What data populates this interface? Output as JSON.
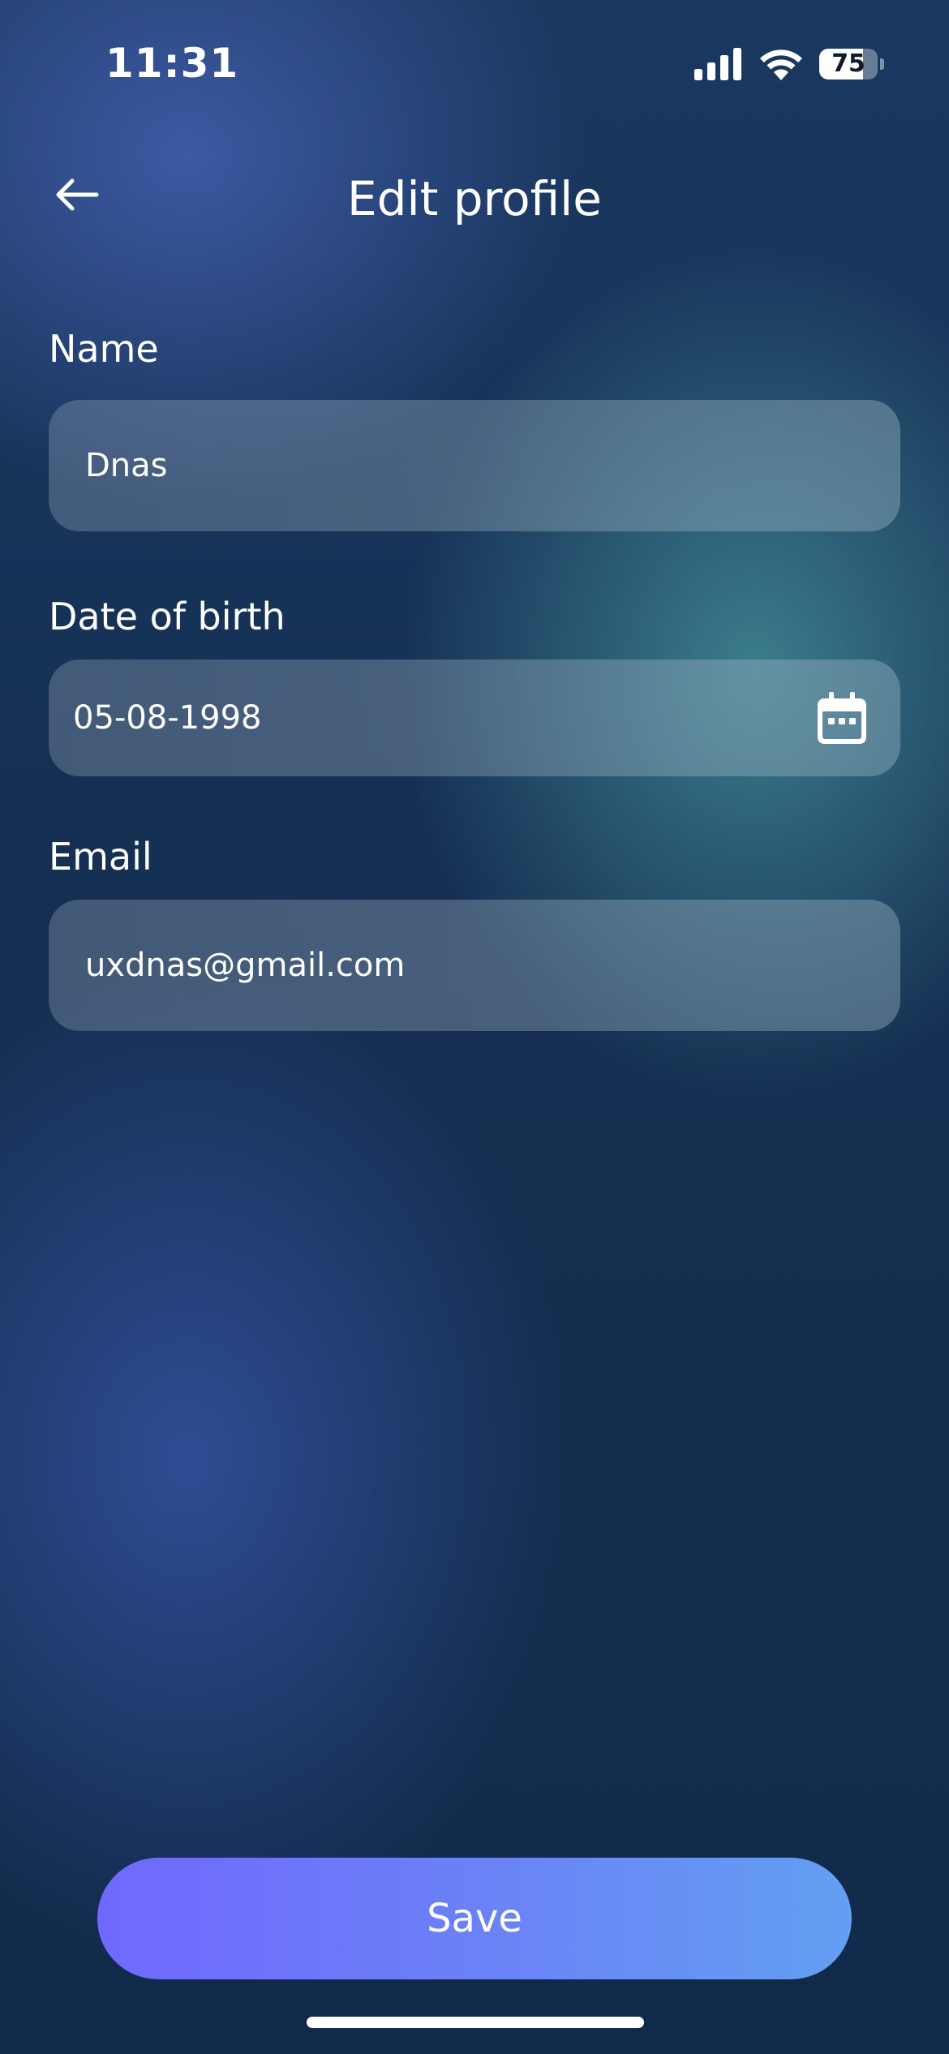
{
  "status_bar": {
    "time": "11:31",
    "battery_level": "75",
    "battery_fraction": 0.75
  },
  "header": {
    "title": "Edit profile",
    "back_icon": "arrow-left-icon"
  },
  "form": {
    "name": {
      "label": "Name",
      "value": "Dnas"
    },
    "date_of_birth": {
      "label": "Date of birth",
      "value": "05-08-1998",
      "icon": "calendar-icon"
    },
    "email": {
      "label": "Email",
      "value": "uxdnas@gmail.com"
    }
  },
  "actions": {
    "save_label": "Save"
  },
  "colors": {
    "background": "#132b48",
    "accent_start": "#7068fe",
    "accent_end": "#639ff2",
    "text": "#ffffff"
  }
}
